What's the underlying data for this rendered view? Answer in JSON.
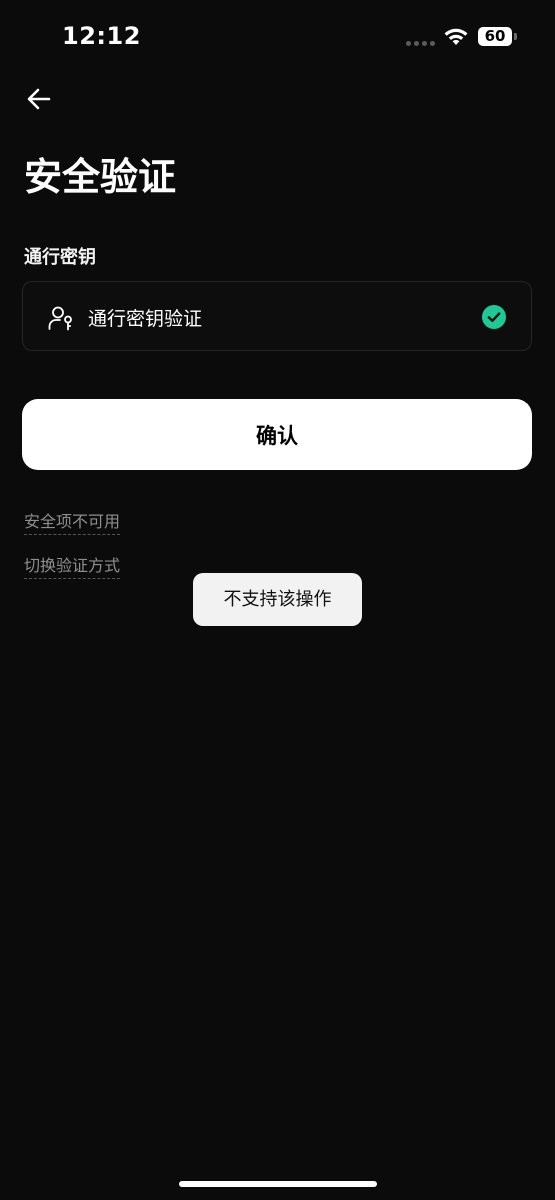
{
  "status_bar": {
    "time": "12:12",
    "battery": "60",
    "icons": [
      "signal-icon",
      "wifi-icon",
      "battery-icon"
    ]
  },
  "header": {
    "back_icon": "arrow-left-icon",
    "title": "安全验证"
  },
  "passkey_section": {
    "label": "通行密钥",
    "option": {
      "icon": "passkey-user-icon",
      "label": "通行密钥验证",
      "selected": true,
      "check_icon": "check-circle-icon"
    }
  },
  "actions": {
    "confirm_label": "确认",
    "unavailable_link": "安全项不可用",
    "switch_link": "切换验证方式"
  },
  "toast": {
    "message": "不支持该操作"
  },
  "colors": {
    "background": "#0b0b0b",
    "check_green": "#1ec997",
    "button_bg": "#ffffff",
    "link_gray": "#8e8e8e"
  }
}
